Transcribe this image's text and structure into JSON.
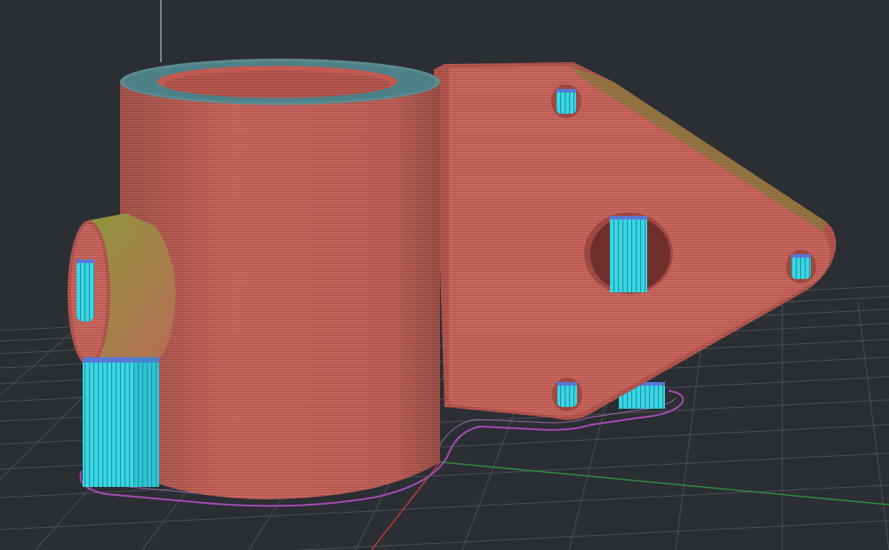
{
  "viewport": {
    "background": "#2b2e33",
    "build_plate_grid_color": "#4a4e55",
    "x_axis_color": "#b23c3c",
    "y_axis_color": "#2e8b3e",
    "z_axis_color": "#9aa0a8"
  },
  "sliced_model": {
    "layer_line_color": "#c9625a",
    "support_color": "#36d6e6",
    "skirt_color": "#a24cb0",
    "features": [
      "cylinder-tube",
      "side-boss",
      "motor-mount-plate",
      "center-hole",
      "screw-holes",
      "support-columns",
      "skirt-outline"
    ]
  }
}
